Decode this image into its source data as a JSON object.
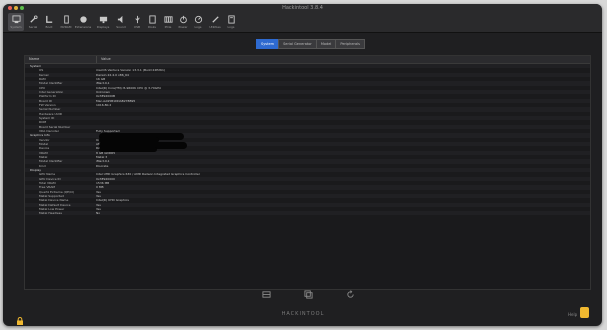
{
  "window": {
    "title": "Hackintool 3.8.4"
  },
  "toolbar": {
    "items": [
      {
        "label": "System",
        "icon": "system-icon"
      },
      {
        "label": "Serial",
        "icon": "wrench-icon"
      },
      {
        "label": "Boot",
        "icon": "boot-icon"
      },
      {
        "label": "NVRAM",
        "icon": "nvram-icon"
      },
      {
        "label": "Extensions",
        "icon": "puzzle-icon"
      },
      {
        "label": "Displays",
        "icon": "display-icon"
      },
      {
        "label": "Sound",
        "icon": "speaker-icon"
      },
      {
        "label": "USB",
        "icon": "usb-icon"
      },
      {
        "label": "Disks",
        "icon": "disk-icon"
      },
      {
        "label": "PCIe",
        "icon": "pcie-icon"
      },
      {
        "label": "Power",
        "icon": "power-icon"
      },
      {
        "label": "Logs",
        "icon": "logs-icon"
      },
      {
        "label": "Utilities",
        "icon": "tools-icon"
      },
      {
        "label": "Logs",
        "icon": "calc-icon"
      }
    ]
  },
  "tabs": [
    "System",
    "Serial Generator",
    "Model",
    "Peripherals"
  ],
  "table": {
    "headers": {
      "name": "Name",
      "value": "Value"
    },
    "rows": [
      {
        "kind": "sec",
        "k": "System",
        "v": ""
      },
      {
        "kind": "sub",
        "k": "OS",
        "v": "macOS Ventura Version 13.3.1 (Build 22E261)"
      },
      {
        "kind": "sub",
        "k": "Kernel",
        "v": "Darwin 22.4.0 x86_64"
      },
      {
        "kind": "sub",
        "k": "RAM",
        "v": "16 GB"
      },
      {
        "kind": "sub",
        "k": "Model Identifier",
        "v": "iMac19,1"
      },
      {
        "kind": "sub",
        "k": "CPU",
        "v": "Intel(R) Core(TM) i5-9600K CPU @ 3.70GHz"
      },
      {
        "kind": "sub",
        "k": "Intel Generation",
        "v": "Unknown"
      },
      {
        "kind": "sub",
        "k": "Platform ID",
        "v": "0x3E92000B"
      },
      {
        "kind": "sub",
        "k": "Board ID",
        "v": "Mac-AA95B1DDAB278B95"
      },
      {
        "kind": "sub",
        "k": "FW Version",
        "v": "1916.80.2"
      },
      {
        "kind": "sub",
        "k": "Serial Number",
        "v": ""
      },
      {
        "kind": "sub",
        "k": "Hardware UUID",
        "v": ""
      },
      {
        "kind": "sub",
        "k": "System ID",
        "v": ""
      },
      {
        "kind": "sub",
        "k": "ROM",
        "v": ""
      },
      {
        "kind": "sub",
        "k": "Board Serial Number",
        "v": ""
      },
      {
        "kind": "sub",
        "k": "VDA Decoder",
        "v": "Fully Supported"
      },
      {
        "kind": "sec",
        "k": "Graphics Info",
        "v": ""
      },
      {
        "kind": "sub",
        "k": "Vendor",
        "v": "Unknown"
      },
      {
        "kind": "sub",
        "k": "Model",
        "v": "AMD"
      },
      {
        "kind": "sub",
        "k": "Device",
        "v": "Radeon RX 580"
      },
      {
        "kind": "sub",
        "k": "VRAM",
        "v": "8 GB GDDR5"
      },
      {
        "kind": "sub",
        "k": "Metal",
        "v": "Metal 3"
      },
      {
        "kind": "sub",
        "k": "Model Identifier",
        "v": "iMac19,1"
      },
      {
        "kind": "sub",
        "k": "Kind",
        "v": "Discrete"
      },
      {
        "kind": "sec",
        "k": "Display",
        "v": ""
      },
      {
        "kind": "sub",
        "k": "GPU Name",
        "v": "Intel UHD Graphics 630 / AMD Radeon Integrated Graphics Controller"
      },
      {
        "kind": "sub",
        "k": "GPU Device ID",
        "v": "0x3E920000"
      },
      {
        "kind": "sub",
        "k": "Total VRAM",
        "v": "1536 MB"
      },
      {
        "kind": "sub",
        "k": "Free VRAM",
        "v": "0 MB"
      },
      {
        "kind": "sub",
        "k": "Quartz Extreme (QE/CI)",
        "v": "Yes"
      },
      {
        "kind": "sub",
        "k": "Metal Supported",
        "v": "Yes"
      },
      {
        "kind": "sub",
        "k": "Metal Device Name",
        "v": "Intel(R) UHD Graphics"
      },
      {
        "kind": "sub",
        "k": "Metal Default Device",
        "v": "Yes"
      },
      {
        "kind": "sub",
        "k": "Metal Low Power",
        "v": "Yes"
      },
      {
        "kind": "sub",
        "k": "Metal Headless",
        "v": "No"
      }
    ]
  },
  "footer": {
    "brand": "HACKINTOOL",
    "status_text": "Help"
  },
  "colors": {
    "accent": "#2e6ad0",
    "background": "#1f1f21",
    "warning": "#f0b830"
  }
}
